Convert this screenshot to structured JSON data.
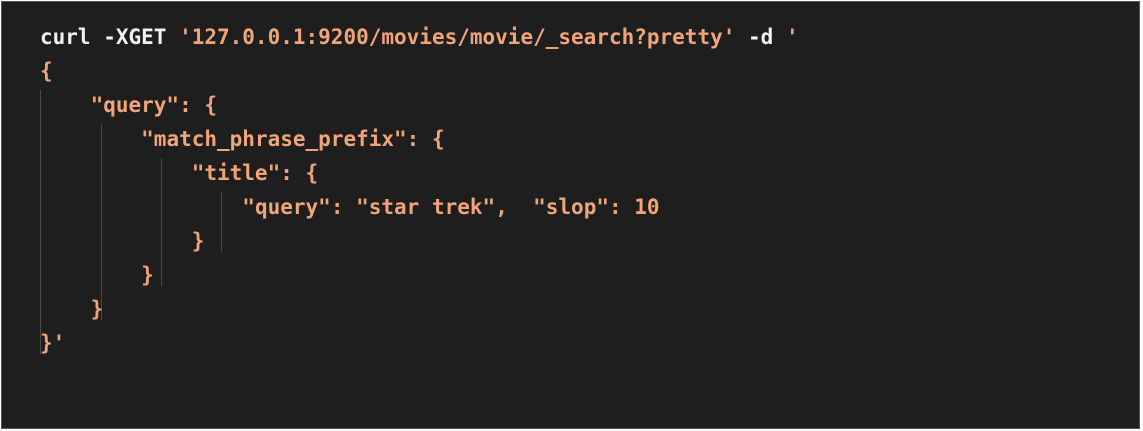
{
  "colors": {
    "background": "#1e1e1e",
    "plain_text": "#f2f2f2",
    "string": "#f0a47a",
    "indent_guide": "#4a4a4a"
  },
  "code": {
    "line1": {
      "cmd": "curl -XGET ",
      "url": "'127.0.0.1:9200/movies/movie/_search?pretty'",
      "flag": " -d ",
      "quote": "'"
    },
    "line2": {
      "brace": "{"
    },
    "line3": {
      "indent": "    ",
      "key": "\"query\"",
      "rest": ": {"
    },
    "line4": {
      "indent": "        ",
      "key": "\"match_phrase_prefix\"",
      "rest": ": {"
    },
    "line5": {
      "indent": "            ",
      "key": "\"title\"",
      "rest": ": {"
    },
    "line6": {
      "indent": "                ",
      "key1": "\"query\"",
      "sep1": ": ",
      "val1": "\"star trek\"",
      "sep2": ",  ",
      "key2": "\"slop\"",
      "sep3": ": ",
      "val2": "10"
    },
    "line7": {
      "indent": "            ",
      "brace": "}"
    },
    "line8": {
      "indent": "        ",
      "brace": "}"
    },
    "line9": {
      "indent": "    ",
      "brace": "}"
    },
    "line10": {
      "brace": "}'"
    }
  }
}
